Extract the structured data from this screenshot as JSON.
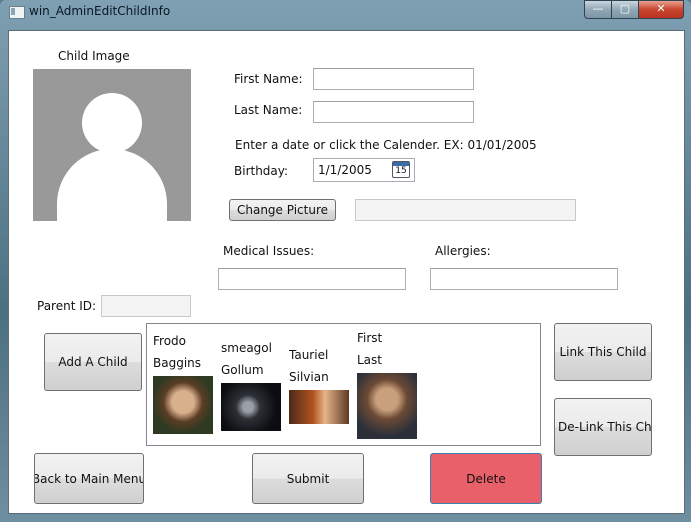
{
  "window": {
    "title": "win_AdminEditChildInfo",
    "controls": {
      "minimize": "—",
      "maximize": "▢",
      "close": "✕"
    }
  },
  "child_image": {
    "label": "Child Image"
  },
  "form": {
    "first_name_label": "First Name:",
    "first_name_value": "",
    "last_name_label": "Last Name:",
    "last_name_value": "",
    "date_hint": "Enter a date or click the Calender. EX: 01/01/2005",
    "birthday_label": "Birthday:",
    "birthday_value": "1/1/2005",
    "calendar_day": "15",
    "change_picture_button": "Change Picture",
    "picture_path_value": "",
    "medical_label": "Medical Issues:",
    "medical_value": "",
    "allergies_label": "Allergies:",
    "allergies_value": "",
    "parent_id_label": "Parent ID:",
    "parent_id_value": ""
  },
  "children": [
    {
      "first": "Frodo",
      "last": "Baggins",
      "photo": "frodo-photo"
    },
    {
      "first": "smeagol",
      "last": "Gollum",
      "photo": "smeagol-photo"
    },
    {
      "first": "Tauriel",
      "last": "Silvian",
      "photo": "tauriel-photo"
    },
    {
      "first": "First",
      "last": "Last",
      "photo": "first-last-photo"
    }
  ],
  "buttons": {
    "add_child": "Add A Child",
    "link_child": "Link This Child",
    "delink_child": "De-Link This Child",
    "back": "Back to Main Menu",
    "submit": "Submit",
    "delete": "Delete"
  },
  "colors": {
    "delete_button": "#e8606a",
    "avatar_bg": "#999999"
  }
}
